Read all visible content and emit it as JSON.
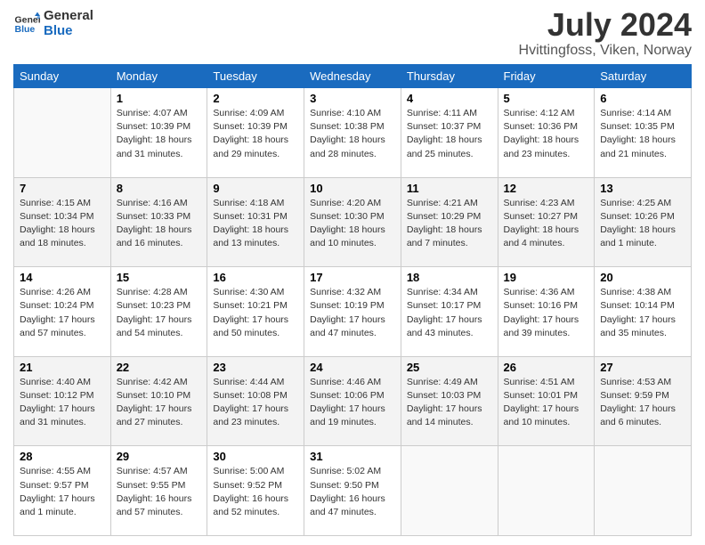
{
  "header": {
    "logo_line1": "General",
    "logo_line2": "Blue",
    "title": "July 2024",
    "subtitle": "Hvittingfoss, Viken, Norway"
  },
  "weekdays": [
    "Sunday",
    "Monday",
    "Tuesday",
    "Wednesday",
    "Thursday",
    "Friday",
    "Saturday"
  ],
  "weeks": [
    [
      {
        "day": "",
        "info": ""
      },
      {
        "day": "1",
        "info": "Sunrise: 4:07 AM\nSunset: 10:39 PM\nDaylight: 18 hours\nand 31 minutes."
      },
      {
        "day": "2",
        "info": "Sunrise: 4:09 AM\nSunset: 10:39 PM\nDaylight: 18 hours\nand 29 minutes."
      },
      {
        "day": "3",
        "info": "Sunrise: 4:10 AM\nSunset: 10:38 PM\nDaylight: 18 hours\nand 28 minutes."
      },
      {
        "day": "4",
        "info": "Sunrise: 4:11 AM\nSunset: 10:37 PM\nDaylight: 18 hours\nand 25 minutes."
      },
      {
        "day": "5",
        "info": "Sunrise: 4:12 AM\nSunset: 10:36 PM\nDaylight: 18 hours\nand 23 minutes."
      },
      {
        "day": "6",
        "info": "Sunrise: 4:14 AM\nSunset: 10:35 PM\nDaylight: 18 hours\nand 21 minutes."
      }
    ],
    [
      {
        "day": "7",
        "info": "Sunrise: 4:15 AM\nSunset: 10:34 PM\nDaylight: 18 hours\nand 18 minutes."
      },
      {
        "day": "8",
        "info": "Sunrise: 4:16 AM\nSunset: 10:33 PM\nDaylight: 18 hours\nand 16 minutes."
      },
      {
        "day": "9",
        "info": "Sunrise: 4:18 AM\nSunset: 10:31 PM\nDaylight: 18 hours\nand 13 minutes."
      },
      {
        "day": "10",
        "info": "Sunrise: 4:20 AM\nSunset: 10:30 PM\nDaylight: 18 hours\nand 10 minutes."
      },
      {
        "day": "11",
        "info": "Sunrise: 4:21 AM\nSunset: 10:29 PM\nDaylight: 18 hours\nand 7 minutes."
      },
      {
        "day": "12",
        "info": "Sunrise: 4:23 AM\nSunset: 10:27 PM\nDaylight: 18 hours\nand 4 minutes."
      },
      {
        "day": "13",
        "info": "Sunrise: 4:25 AM\nSunset: 10:26 PM\nDaylight: 18 hours\nand 1 minute."
      }
    ],
    [
      {
        "day": "14",
        "info": "Sunrise: 4:26 AM\nSunset: 10:24 PM\nDaylight: 17 hours\nand 57 minutes."
      },
      {
        "day": "15",
        "info": "Sunrise: 4:28 AM\nSunset: 10:23 PM\nDaylight: 17 hours\nand 54 minutes."
      },
      {
        "day": "16",
        "info": "Sunrise: 4:30 AM\nSunset: 10:21 PM\nDaylight: 17 hours\nand 50 minutes."
      },
      {
        "day": "17",
        "info": "Sunrise: 4:32 AM\nSunset: 10:19 PM\nDaylight: 17 hours\nand 47 minutes."
      },
      {
        "day": "18",
        "info": "Sunrise: 4:34 AM\nSunset: 10:17 PM\nDaylight: 17 hours\nand 43 minutes."
      },
      {
        "day": "19",
        "info": "Sunrise: 4:36 AM\nSunset: 10:16 PM\nDaylight: 17 hours\nand 39 minutes."
      },
      {
        "day": "20",
        "info": "Sunrise: 4:38 AM\nSunset: 10:14 PM\nDaylight: 17 hours\nand 35 minutes."
      }
    ],
    [
      {
        "day": "21",
        "info": "Sunrise: 4:40 AM\nSunset: 10:12 PM\nDaylight: 17 hours\nand 31 minutes."
      },
      {
        "day": "22",
        "info": "Sunrise: 4:42 AM\nSunset: 10:10 PM\nDaylight: 17 hours\nand 27 minutes."
      },
      {
        "day": "23",
        "info": "Sunrise: 4:44 AM\nSunset: 10:08 PM\nDaylight: 17 hours\nand 23 minutes."
      },
      {
        "day": "24",
        "info": "Sunrise: 4:46 AM\nSunset: 10:06 PM\nDaylight: 17 hours\nand 19 minutes."
      },
      {
        "day": "25",
        "info": "Sunrise: 4:49 AM\nSunset: 10:03 PM\nDaylight: 17 hours\nand 14 minutes."
      },
      {
        "day": "26",
        "info": "Sunrise: 4:51 AM\nSunset: 10:01 PM\nDaylight: 17 hours\nand 10 minutes."
      },
      {
        "day": "27",
        "info": "Sunrise: 4:53 AM\nSunset: 9:59 PM\nDaylight: 17 hours\nand 6 minutes."
      }
    ],
    [
      {
        "day": "28",
        "info": "Sunrise: 4:55 AM\nSunset: 9:57 PM\nDaylight: 17 hours\nand 1 minute."
      },
      {
        "day": "29",
        "info": "Sunrise: 4:57 AM\nSunset: 9:55 PM\nDaylight: 16 hours\nand 57 minutes."
      },
      {
        "day": "30",
        "info": "Sunrise: 5:00 AM\nSunset: 9:52 PM\nDaylight: 16 hours\nand 52 minutes."
      },
      {
        "day": "31",
        "info": "Sunrise: 5:02 AM\nSunset: 9:50 PM\nDaylight: 16 hours\nand 47 minutes."
      },
      {
        "day": "",
        "info": ""
      },
      {
        "day": "",
        "info": ""
      },
      {
        "day": "",
        "info": ""
      }
    ]
  ]
}
